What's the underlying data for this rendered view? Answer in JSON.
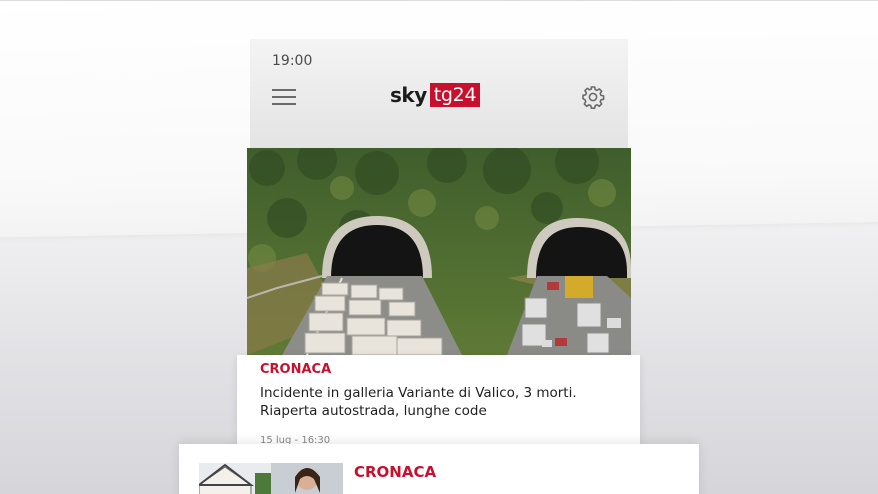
{
  "status_bar": {
    "time": "19:00"
  },
  "header": {
    "logo_sky": "sky",
    "logo_tg": "tg24",
    "menu_icon": "hamburger-menu-icon",
    "settings_icon": "gear-icon"
  },
  "main_article": {
    "category": "CRONACA",
    "title": "Incidente in galleria Variante di Valico, 3 morti. Riaperta autostrada, lunghe code",
    "date": "15 lug - 16:30"
  },
  "second_article": {
    "category": "CRONACA"
  },
  "colors": {
    "brand_red": "#c8102e",
    "text_dark": "#1f1f1f"
  }
}
